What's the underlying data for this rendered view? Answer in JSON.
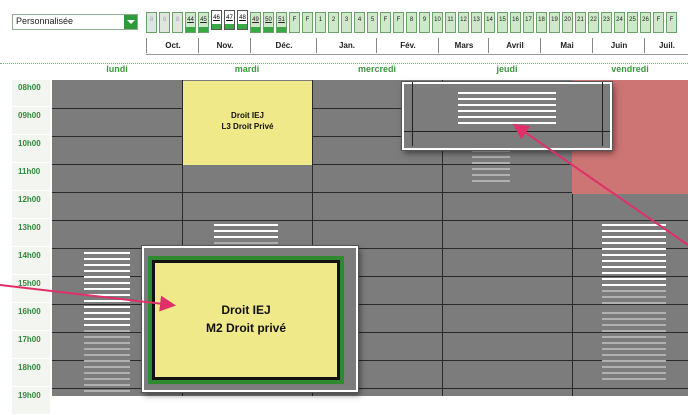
{
  "view_select": {
    "value": "Personnalisée"
  },
  "weeks": [
    "8",
    "8",
    "8",
    "44",
    "45",
    "46",
    "47",
    "48",
    "49",
    "50",
    "51",
    "F",
    "F",
    "1",
    "2",
    "3",
    "4",
    "5",
    "F",
    "F",
    "8",
    "9",
    "10",
    "11",
    "12",
    "13",
    "14",
    "15",
    "16",
    "17",
    "18",
    "19",
    "20",
    "21",
    "22",
    "23",
    "24",
    "25",
    "26",
    "F",
    "F"
  ],
  "months": [
    "Oct.",
    "Nov.",
    "Déc.",
    "Jan.",
    "Fév.",
    "Mars",
    "Avril",
    "Mai",
    "Juin",
    "Juil."
  ],
  "days": [
    "lundi",
    "mardi",
    "mercredi",
    "jeudi",
    "vendredi"
  ],
  "hours": [
    "08h00",
    "09h00",
    "10h00",
    "11h00",
    "12h00",
    "13h00",
    "14h00",
    "15h00",
    "16h00",
    "17h00",
    "18h00",
    "19h00"
  ],
  "courses": {
    "mardi_course": {
      "line1": "Droit IEJ",
      "line2": "L3 Droit Privé"
    },
    "zoom_course": {
      "line1": "Droit IEJ",
      "line2": "M2 Droit privé"
    }
  },
  "colors": {
    "grid": "#7c7c7c",
    "course_yellow": "#efe98a",
    "course_red": "#cd7474",
    "accent": "#2e9b3a",
    "arrow": "#e0306a"
  }
}
